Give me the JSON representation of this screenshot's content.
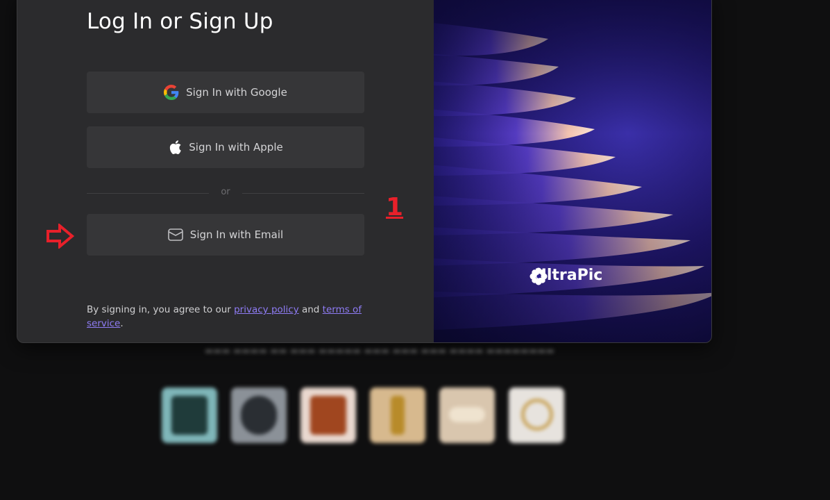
{
  "modal": {
    "title": "Log In or Sign Up",
    "buttons": {
      "google": {
        "label": "Sign In with Google",
        "icon": "google-icon"
      },
      "apple": {
        "label": "Sign In with Apple",
        "icon": "apple-icon"
      },
      "email": {
        "label": "Sign In with Email",
        "icon": "mail-icon"
      }
    },
    "divider_text": "or",
    "legal": {
      "prefix": "By signing in, you agree to our ",
      "privacy_link": "privacy policy",
      "middle": " and ",
      "terms_link": "terms of service",
      "suffix": "."
    },
    "brand": {
      "name": "UltraPic",
      "icon": "flower-logo-icon"
    },
    "link_color": "#8f7cf5"
  },
  "annotation": {
    "marker_number": "1",
    "color": "#e8202a",
    "arrow_icon": "right-arrow-icon"
  },
  "background": {
    "thumbnails": [
      {
        "name": "phone-case-thumbnail"
      },
      {
        "name": "watch-thumbnail"
      },
      {
        "name": "leather-wallet-thumbnail"
      },
      {
        "name": "perfume-bottle-thumbnail"
      },
      {
        "name": "bracelet-thumbnail"
      },
      {
        "name": "ring-thumbnail"
      }
    ]
  }
}
